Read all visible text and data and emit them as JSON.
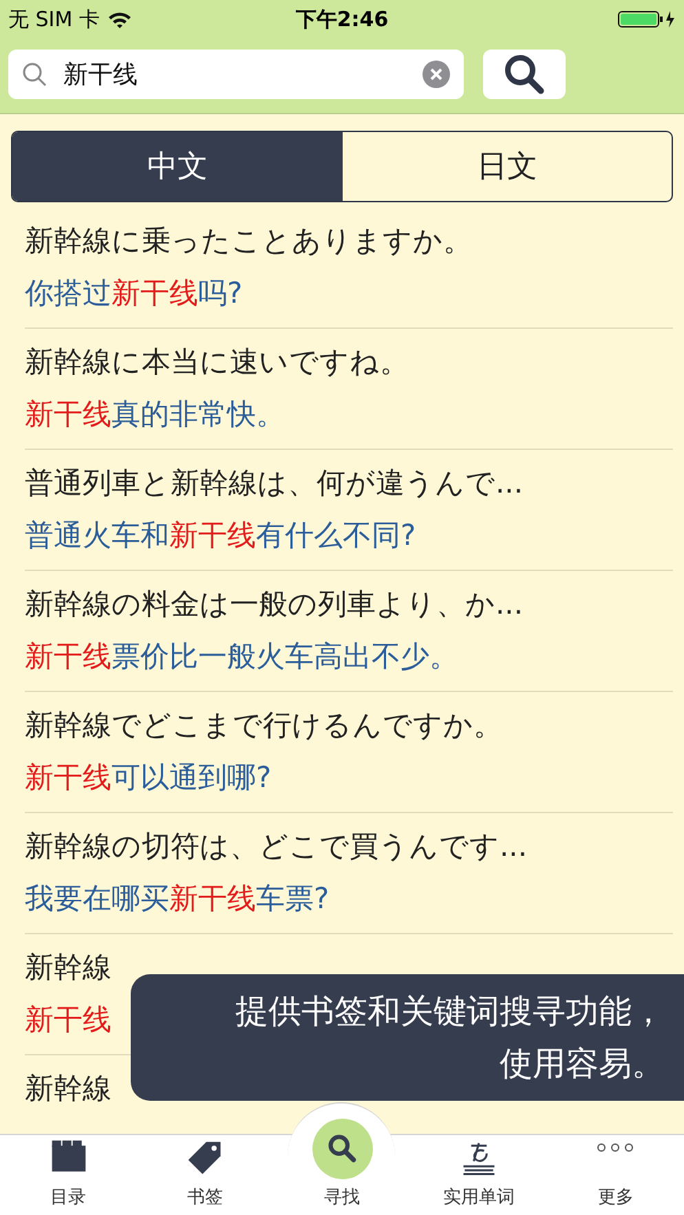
{
  "status_bar": {
    "carrier": "无 SIM 卡",
    "time": "下午2:46"
  },
  "search": {
    "value": "新干线"
  },
  "segments": [
    {
      "label": "中文",
      "selected": true
    },
    {
      "label": "日文",
      "selected": false
    }
  ],
  "rows": [
    {
      "japanese": "新幹線に乗ったことありますか。",
      "chinese": [
        {
          "text": "你搭过",
          "highlight": false
        },
        {
          "text": "新干线",
          "highlight": true
        },
        {
          "text": "吗?",
          "highlight": false
        }
      ]
    },
    {
      "japanese": "新幹線に本当に速いですね。",
      "chinese": [
        {
          "text": "新干线",
          "highlight": true
        },
        {
          "text": "真的非常快。",
          "highlight": false
        }
      ]
    },
    {
      "japanese": "普通列車と新幹線は、何が違うんで...",
      "chinese": [
        {
          "text": "普通火车和",
          "highlight": false
        },
        {
          "text": "新干线",
          "highlight": true
        },
        {
          "text": "有什么不同?",
          "highlight": false
        }
      ]
    },
    {
      "japanese": "新幹線の料金は一般の列車より、か...",
      "chinese": [
        {
          "text": "新干线",
          "highlight": true
        },
        {
          "text": "票价比一般火车高出不少。",
          "highlight": false
        }
      ]
    },
    {
      "japanese": "新幹線でどこまで行けるんですか。",
      "chinese": [
        {
          "text": "新干线",
          "highlight": true
        },
        {
          "text": "可以通到哪?",
          "highlight": false
        }
      ]
    },
    {
      "japanese": "新幹線の切符は、どこで買うんです...",
      "chinese": [
        {
          "text": "我要在哪买",
          "highlight": false
        },
        {
          "text": "新干线",
          "highlight": true
        },
        {
          "text": "车票?",
          "highlight": false
        }
      ]
    },
    {
      "japanese": "新幹線",
      "chinese": [
        {
          "text": "新干线",
          "highlight": true
        }
      ]
    },
    {
      "japanese": "新幹線"
    }
  ],
  "toast": {
    "lines": [
      "提供书签和关键词搜寻功能，",
      "使用容易。"
    ]
  },
  "tab_bar": [
    {
      "label": "目录",
      "kind": "folder",
      "selected": false
    },
    {
      "label": "书签",
      "kind": "tag",
      "selected": false
    },
    {
      "label": "寻找",
      "kind": "search",
      "selected": true
    },
    {
      "label": "实用单词",
      "kind": "words",
      "selected": false
    },
    {
      "label": "更多",
      "kind": "more",
      "selected": false
    }
  ]
}
